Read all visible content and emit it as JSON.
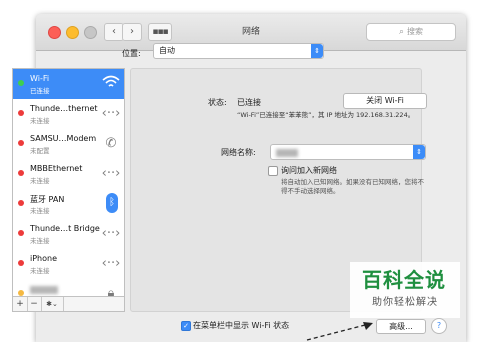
{
  "window": {
    "title": "网络",
    "search_placeholder": "搜索",
    "colors": {
      "close": "#fc5f57",
      "minimize": "#fdbc2e",
      "accent": "#3d8cf7"
    }
  },
  "toolbar": {
    "back_icon": "chevron-left-icon",
    "forward_icon": "chevron-right-icon",
    "grid_icon": "grid-icon"
  },
  "location": {
    "label": "位置:",
    "value": "自动"
  },
  "services": [
    {
      "name": "Wi-Fi",
      "status": "已连接",
      "dot": "#3ecf4e",
      "icon": "wifi-icon"
    },
    {
      "name": "Thunde…thernet",
      "status": "未连接",
      "dot": "#ed3b3b",
      "icon": "ethernet-arrows-icon"
    },
    {
      "name": "SAMSU…Modem",
      "status": "未配置",
      "dot": "#ed3b3b",
      "icon": "phone-modem-icon"
    },
    {
      "name": "MBBEthernet",
      "status": "未连接",
      "dot": "#ed3b3b",
      "icon": "ethernet-arrows-icon"
    },
    {
      "name": "蓝牙 PAN",
      "status": "未连接",
      "dot": "#ed3b3b",
      "icon": "bluetooth-icon"
    },
    {
      "name": "Thunde…t Bridge",
      "status": "未连接",
      "dot": "#ed3b3b",
      "icon": "ethernet-arrows-icon"
    },
    {
      "name": "iPhone",
      "status": "未连接",
      "dot": "#ed3b3b",
      "icon": "ethernet-arrows-icon"
    },
    {
      "name": "",
      "status": "",
      "dot": "#f5b942",
      "icon": "vpn-lock-icon"
    }
  ],
  "sidebar_tools": {
    "add": "+",
    "remove": "−",
    "gear": "✱⌄"
  },
  "detail": {
    "status_label": "状态:",
    "status_value": "已连接",
    "turn_off_button": "关闭 Wi-Fi",
    "status_desc": "“Wi-Fi”已连接至“苯苯熊”，其 IP 地址为 192.168.31.224。",
    "network_name_label": "网络名称:",
    "ask_join_label": "询问加入新网络",
    "ask_join_desc": "将自动加入已知网络。如果没有已知网络，您将不得不手动选择网络。",
    "show_in_menubar_label": "在菜单栏中显示 Wi-Fi 状态",
    "advanced_button": "高级...",
    "help_button": "?"
  },
  "watermark": {
    "title": "百科全说",
    "subtitle": "助你轻松解决"
  }
}
